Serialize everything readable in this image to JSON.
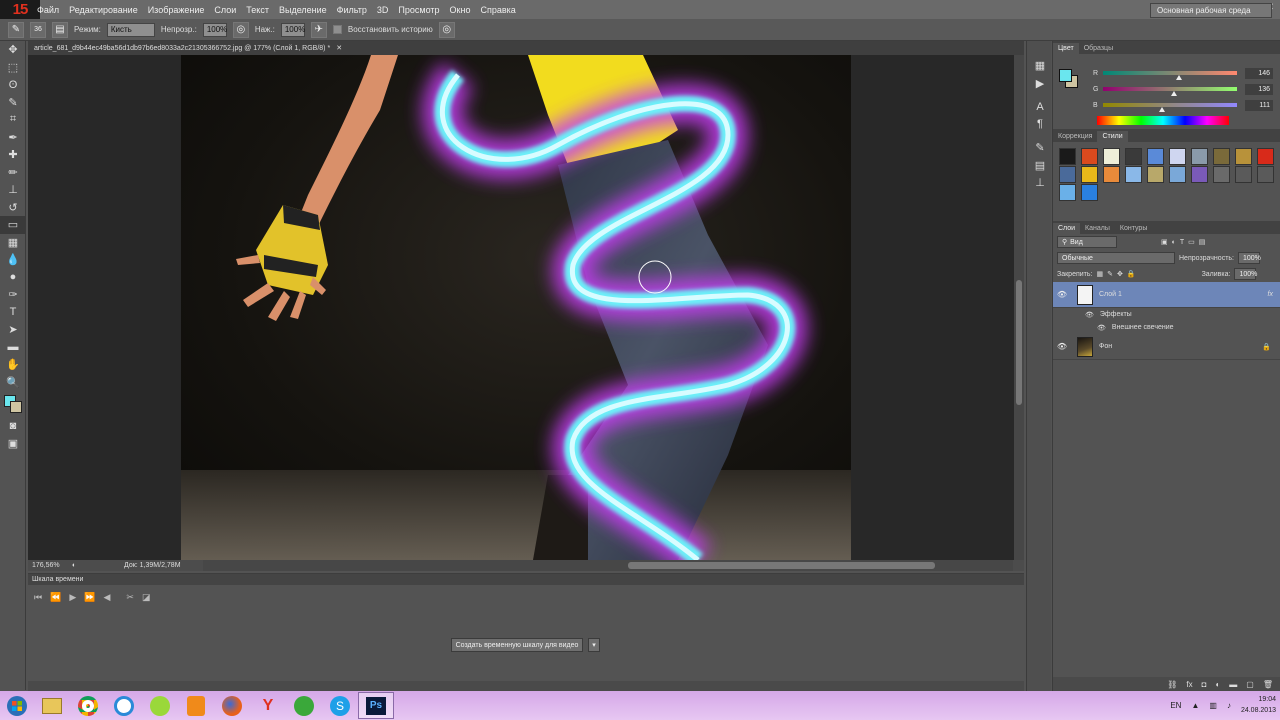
{
  "app": {
    "logo": "15"
  },
  "menu": [
    "Файл",
    "Редактирование",
    "Изображение",
    "Слои",
    "Текст",
    "Выделение",
    "Фильтр",
    "3D",
    "Просмотр",
    "Окно",
    "Справка"
  ],
  "window_controls": [
    "–",
    "▭",
    "✕"
  ],
  "options": {
    "mode_label": "Режим:",
    "mode_value": "Кисть",
    "opacity_label": "Непрозр.:",
    "opacity_value": "100%",
    "flow_label": "Наж.:",
    "flow_value": "100%",
    "history_label": "Восстановить историю",
    "workspace": "Основная рабочая среда"
  },
  "document": {
    "tab_title": "article_681_d9b44ec49ba56d1db97b6ed8033a2c21305366752.jpg @ 177% (Слой 1, RGB/8) *",
    "zoom": "176,56%",
    "doc_size": "Док: 1,39М/2,78М"
  },
  "timeline": {
    "title": "Шкала времени",
    "create_button": "Создать временную шкалу для видео"
  },
  "color_panel": {
    "tabs": [
      "Цвет",
      "Образцы"
    ],
    "channels": [
      {
        "name": "R",
        "value": "146",
        "level": 0.57
      },
      {
        "name": "G",
        "value": "136",
        "level": 0.53
      },
      {
        "name": "B",
        "value": "111",
        "level": 0.44
      }
    ],
    "foreground": "#6ae6ee",
    "background": "#cfc5a2"
  },
  "styles_panel": {
    "tabs": [
      "Коррекция",
      "Стили"
    ],
    "swatches": [
      "#1a1a1a",
      "#d94a1e",
      "#eeeed8",
      "#3a3a3a",
      "#5a8ad8",
      "#cfd6f0",
      "#8a9aaa",
      "#7a6a3a",
      "#b8923a",
      "#d82a1a",
      "#4a6a9a",
      "#e8b81a",
      "#e88a3a",
      "#8ab8e8",
      "#b8a86a",
      "#7aa8d8",
      "#7a5ab8",
      "#6a6a6a",
      "#5a5a5a",
      "#5a5a5a",
      "#6ab0e8",
      "#2a80e0"
    ]
  },
  "layers_panel": {
    "tabs": [
      "Слои",
      "Каналы",
      "Контуры"
    ],
    "filter": "Вид",
    "blend_mode": "Обычные",
    "opacity_label": "Непрозрачность:",
    "opacity_value": "100%",
    "lock_label": "Закрепить:",
    "fill_label": "Заливка:",
    "fill_value": "100%",
    "layers": [
      {
        "name": "Слой 1",
        "selected": true,
        "fx": "fx"
      },
      {
        "name": "Фон",
        "selected": false
      }
    ],
    "effects_label": "Эффекты",
    "outer_glow_label": "Внешнее свечение"
  },
  "taskbar": {
    "lang": "EN",
    "time": "19:04",
    "date": "24.08.2013",
    "apps": [
      "explorer-icon",
      "chrome-icon",
      "ok-browser-icon",
      "odnoklassniki-icon",
      "firefox-icon",
      "yandex-icon",
      "utorrent-icon",
      "skype-icon",
      "photoshop-icon"
    ],
    "ps_label": "Ps"
  }
}
